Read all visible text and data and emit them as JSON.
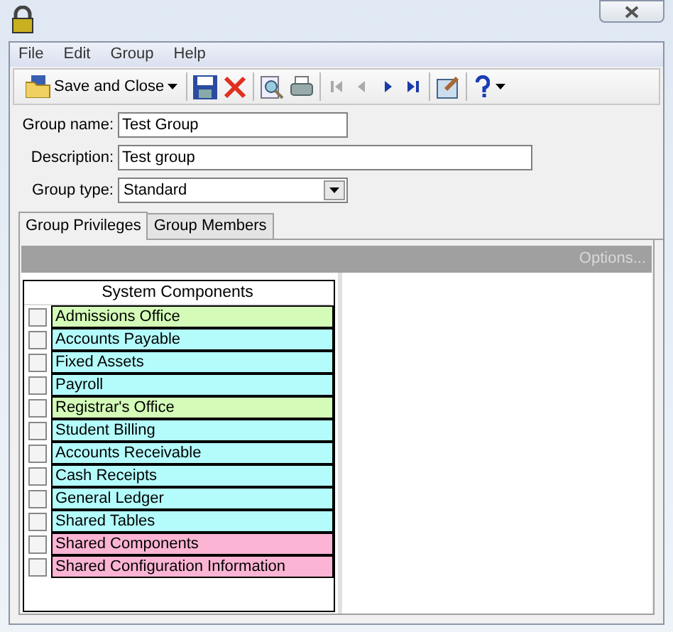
{
  "menu": [
    "File",
    "Edit",
    "Group",
    "Help"
  ],
  "toolbar": {
    "save_and_close": "Save and Close"
  },
  "form": [
    {
      "label": "Group name:",
      "value": "Test Group",
      "kind": "text"
    },
    {
      "label": "Description:",
      "value": "Test group",
      "kind": "text"
    },
    {
      "label": "Group type:",
      "value": "Standard",
      "kind": "select"
    }
  ],
  "tabs": [
    {
      "label": "Group Privileges",
      "selected": true
    },
    {
      "label": "Group Members",
      "selected": false
    }
  ],
  "options_bar": {
    "label": "Options..."
  },
  "components": {
    "header": "System Components",
    "items": [
      {
        "label": "Admissions Office",
        "checked": false,
        "color": "#d4fcb8"
      },
      {
        "label": "Accounts Payable",
        "checked": false,
        "color": "#b4fcfc"
      },
      {
        "label": "Fixed Assets",
        "checked": false,
        "color": "#b4fcfc"
      },
      {
        "label": "Payroll",
        "checked": false,
        "color": "#b4fcfc"
      },
      {
        "label": "Registrar's Office",
        "checked": false,
        "color": "#d4fcb8"
      },
      {
        "label": "Student Billing",
        "checked": false,
        "color": "#b4fcfc"
      },
      {
        "label": "Accounts Receivable",
        "checked": false,
        "color": "#b4fcfc"
      },
      {
        "label": "Cash Receipts",
        "checked": false,
        "color": "#b4fcfc"
      },
      {
        "label": "General Ledger",
        "checked": false,
        "color": "#b4fcfc"
      },
      {
        "label": "Shared Tables",
        "checked": false,
        "color": "#b4fcfc"
      },
      {
        "label": "Shared Components",
        "checked": false,
        "color": "#fcb4d4"
      },
      {
        "label": "Shared Configuration Information",
        "checked": false,
        "color": "#fcb4d4"
      }
    ]
  }
}
